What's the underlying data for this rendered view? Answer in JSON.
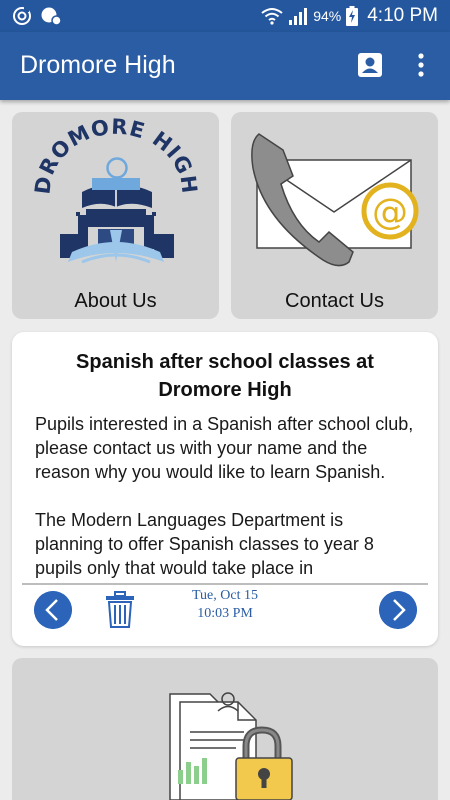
{
  "status_bar": {
    "battery": "94%",
    "time": "4:10 PM"
  },
  "app_bar": {
    "title": "Dromore High",
    "account_icon": "account-box-icon",
    "menu_icon": "more-vert-icon"
  },
  "tiles": {
    "about": {
      "label": "About Us",
      "logo_text": "DROMORE HIGH"
    },
    "contact": {
      "label": "Contact Us"
    }
  },
  "news": {
    "title": "Spanish after school classes at Dromore High",
    "paragraphs": [
      "Pupils interested in a Spanish after school club, please contact us with your name and the reason why you would like to learn Spanish.",
      "The Modern Languages Department is planning to offer Spanish classes to year 8 pupils only that would take place in"
    ],
    "date": "Tue, Oct 15",
    "time": "10:03 PM"
  },
  "colors": {
    "app_bar": "#2b5da4",
    "status_bar": "#25579e",
    "nav_button": "#2b64b8",
    "tile": "#d4d4d4"
  }
}
